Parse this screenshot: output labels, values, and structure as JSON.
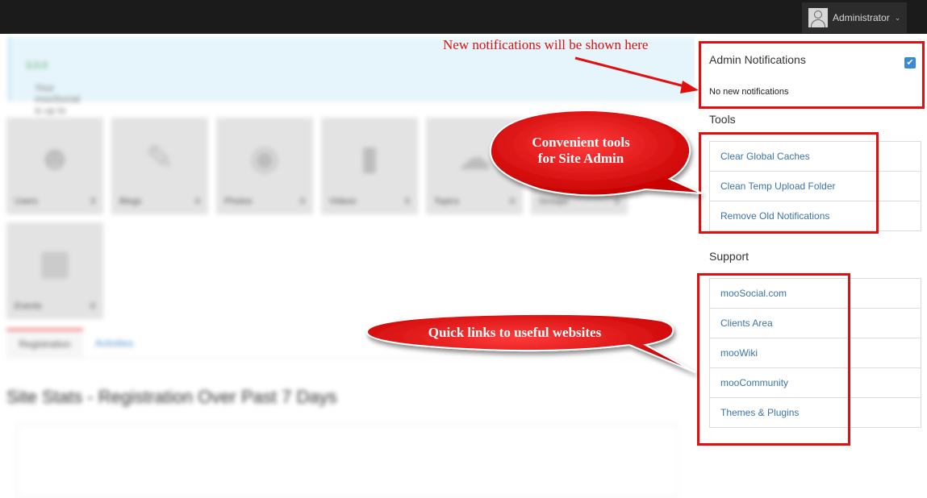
{
  "header": {
    "user_name": "Administrator",
    "caret": "⌄"
  },
  "dashboard": {
    "alert_text": "Your mooSocial is up to date",
    "alert_version": "3.0.0",
    "tiles": [
      {
        "label": "Users",
        "count": "3",
        "icon": "users-icon"
      },
      {
        "label": "Blogs",
        "count": "0",
        "icon": "pencil-icon"
      },
      {
        "label": "Photos",
        "count": "0",
        "icon": "camera-icon"
      },
      {
        "label": "Videos",
        "count": "0",
        "icon": "video-camera-icon"
      },
      {
        "label": "Topics",
        "count": "0",
        "icon": "chat-bubble-icon"
      },
      {
        "label": "Groups",
        "count": "0",
        "icon": "group-icon"
      },
      {
        "label": "Events",
        "count": "0",
        "icon": "calendar-icon"
      }
    ],
    "tabs": [
      "Registration",
      "Activities"
    ],
    "stats_title": "Site Stats - Registration Over Past 7 Days"
  },
  "notifications": {
    "title": "Admin Notifications",
    "empty_text": "No new notifications",
    "check_glyph": "✔"
  },
  "tools": {
    "title": "Tools",
    "items": [
      "Clear Global Caches",
      "Clean Temp Upload Folder",
      "Remove Old Notifications"
    ]
  },
  "support": {
    "title": "Support",
    "items": [
      "mooSocial.com",
      "Clients Area",
      "mooWiki",
      "mooCommunity",
      "Themes & Plugins"
    ]
  },
  "annotations": {
    "new_notifications": "New notifications will be shown here",
    "tools_line1": "Convenient tools",
    "tools_line2": "for Site Admin",
    "quick_links": "Quick links to useful websites"
  },
  "colors": {
    "annotation_red": "#e01010",
    "link_blue": "#3c74a8",
    "topbar": "#1b1b1b"
  }
}
